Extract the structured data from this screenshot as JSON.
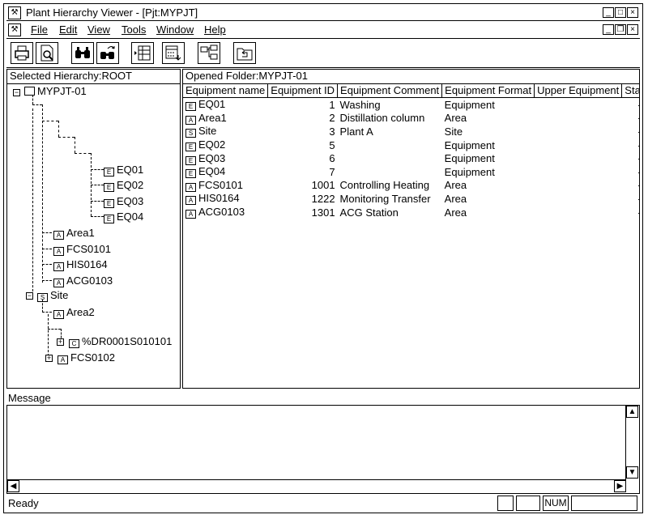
{
  "window": {
    "title": "Plant Hierarchy Viewer - [Pjt:MYPJT]"
  },
  "menu": [
    "File",
    "Edit",
    "View",
    "Tools",
    "Window",
    "Help"
  ],
  "left_pane": {
    "header": "Selected Hierarchy:ROOT",
    "tree": {
      "root": "MYPJT-01",
      "eq": [
        "EQ01",
        "EQ02",
        "EQ03",
        "EQ04"
      ],
      "areas": [
        "Area1",
        "FCS0101",
        "HIS0164",
        "ACG0103"
      ],
      "site": "Site",
      "area2": "Area2",
      "dr": "%DR0001S010101",
      "fcs2": "FCS0102"
    }
  },
  "right_pane": {
    "header": "Opened Folder:MYPJT-01",
    "columns": [
      "Equipment name",
      "Equipment ID",
      "Equipment Comment",
      "Equipment Format",
      "Upper Equipment",
      "Status"
    ],
    "rows": [
      {
        "icon": "equipment-icon",
        "name": "EQ01",
        "id": "1",
        "comment": "Washing",
        "format": "Equipment",
        "upper": "",
        "status": "-"
      },
      {
        "icon": "area-icon",
        "name": "Area1",
        "id": "2",
        "comment": "Distillation column",
        "format": "Area",
        "upper": "",
        "status": "-"
      },
      {
        "icon": "site-icon",
        "name": "Site",
        "id": "3",
        "comment": "Plant A",
        "format": "Site",
        "upper": "",
        "status": "-"
      },
      {
        "icon": "equipment-icon",
        "name": "EQ02",
        "id": "5",
        "comment": "",
        "format": "Equipment",
        "upper": "",
        "status": "-"
      },
      {
        "icon": "equipment-icon",
        "name": "EQ03",
        "id": "6",
        "comment": "",
        "format": "Equipment",
        "upper": "",
        "status": "-"
      },
      {
        "icon": "equipment-icon",
        "name": "EQ04",
        "id": "7",
        "comment": "",
        "format": "Equipment",
        "upper": "",
        "status": "-"
      },
      {
        "icon": "area-icon",
        "name": "FCS0101",
        "id": "1001",
        "comment": "Controlling Heating",
        "format": "Area",
        "upper": "",
        "status": "-"
      },
      {
        "icon": "area-icon",
        "name": "HIS0164",
        "id": "1222",
        "comment": "Monitoring Transfer",
        "format": "Area",
        "upper": "",
        "status": "-"
      },
      {
        "icon": "area-icon",
        "name": "ACG0103",
        "id": "1301",
        "comment": "ACG Station",
        "format": "Area",
        "upper": "",
        "status": "-"
      }
    ]
  },
  "message": {
    "label": "Message"
  },
  "status": {
    "text": "Ready",
    "num": "NUM"
  }
}
